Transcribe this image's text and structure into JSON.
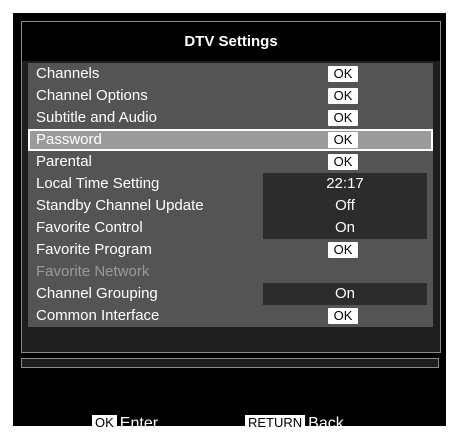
{
  "title": "DTV Settings",
  "ok_label": "OK",
  "menu": [
    {
      "label": "Channels",
      "kind": "button"
    },
    {
      "label": "Channel Options",
      "kind": "button"
    },
    {
      "label": "Subtitle and Audio",
      "kind": "button"
    },
    {
      "label": "Password",
      "kind": "button",
      "selected": true
    },
    {
      "label": "Parental",
      "kind": "button"
    },
    {
      "label": "Local Time Setting",
      "kind": "value",
      "value": "22:17"
    },
    {
      "label": "Standby Channel Update",
      "kind": "value",
      "value": "Off"
    },
    {
      "label": "Favorite Control",
      "kind": "value",
      "value": "On"
    },
    {
      "label": "Favorite Program",
      "kind": "button"
    },
    {
      "label": "Favorite Network",
      "kind": "none",
      "disabled": true
    },
    {
      "label": "Channel Grouping",
      "kind": "value",
      "value": "On"
    },
    {
      "label": "Common Interface",
      "kind": "button"
    }
  ],
  "footer": {
    "enter_key": "OK",
    "enter_label": "Enter",
    "back_key": "RETURN",
    "back_label": "Back"
  }
}
